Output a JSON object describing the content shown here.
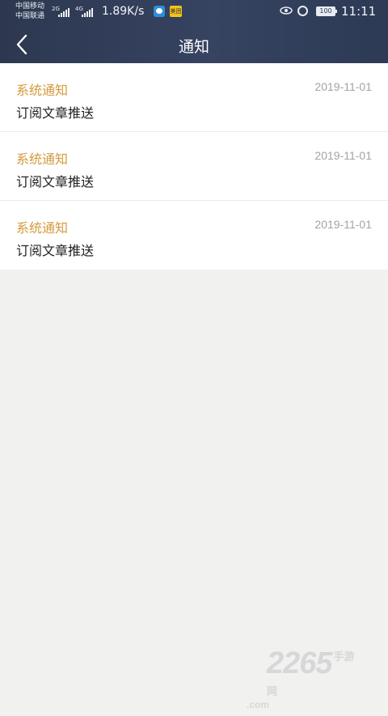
{
  "status_bar": {
    "carrier_1": "中国移动",
    "carrier_2": "中国联通",
    "network_1": "2G",
    "network_2": "4G",
    "net_speed": "1.89K/s",
    "app_badge": "美团",
    "battery": "100",
    "time": "11:11"
  },
  "header": {
    "title": "通知",
    "back_icon": "chevron-left-icon"
  },
  "notifications": [
    {
      "title": "系统通知",
      "date": "2019-11-01",
      "body": "订阅文章推送"
    },
    {
      "title": "系统通知",
      "date": "2019-11-01",
      "body": "订阅文章推送"
    },
    {
      "title": "系统通知",
      "date": "2019-11-01",
      "body": "订阅文章推送"
    }
  ],
  "watermark": {
    "brand": "2265",
    "suffix": "手游网",
    "domain_suffix": ".com"
  },
  "colors": {
    "header_bg": "#323e5a",
    "notification_title": "#d49a3c",
    "page_bg": "#f1f1f0"
  }
}
